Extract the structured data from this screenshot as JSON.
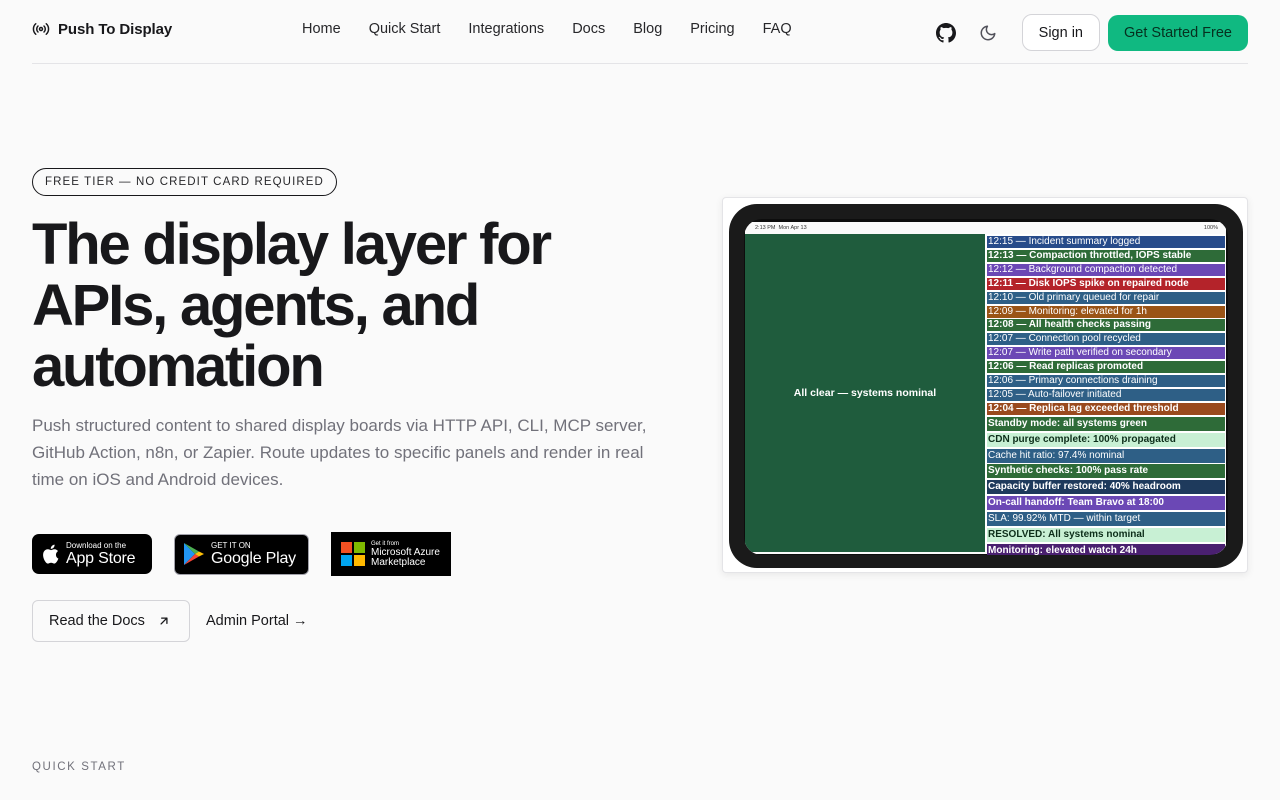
{
  "brand": {
    "name": "Push To Display"
  },
  "nav": {
    "items": [
      "Home",
      "Quick Start",
      "Integrations",
      "Docs",
      "Blog",
      "Pricing",
      "FAQ"
    ]
  },
  "header_actions": {
    "signin": "Sign in",
    "cta": "Get Started Free"
  },
  "hero": {
    "badge": "FREE TIER — NO CREDIT CARD REQUIRED",
    "title": "The display layer for APIs, agents, and automation",
    "subtitle": "Push structured content to shared display boards via HTTP API, CLI, MCP server, GitHub Action, n8n, or Zapier. Route updates to specific panels and render in real time on iOS and Android devices."
  },
  "stores": {
    "apple_small": "Download on the",
    "apple_big": "App Store",
    "google_small": "GET IT ON",
    "google_big": "Google Play",
    "azure_small": "Get it from",
    "azure_big1": "Microsoft Azure",
    "azure_big2": "Marketplace"
  },
  "buttons": {
    "docs": "Read the Docs",
    "admin": "Admin Portal →"
  },
  "section": {
    "quick_start": "QUICK START"
  },
  "device": {
    "time": "2:13 PM",
    "date": "Mon Apr 13",
    "battery": "100%",
    "panel_left": "All clear — systems nominal",
    "log": [
      {
        "text": "12:15 — Incident summary logged",
        "color": "#274b8a",
        "bold": false
      },
      {
        "text": "12:13 — Compaction throttled, IOPS stable",
        "color": "#2e6b38",
        "bold": true
      },
      {
        "text": "12:12 — Background compaction detected",
        "color": "#6b48b5",
        "bold": false
      },
      {
        "text": "12:11 — Disk IOPS spike on repaired node",
        "color": "#b4232a",
        "bold": true
      },
      {
        "text": "12:10 — Old primary queued for repair",
        "color": "#2e5f86",
        "bold": false
      },
      {
        "text": "12:09 — Monitoring: elevated for 1h",
        "color": "#9a5416",
        "bold": false
      },
      {
        "text": "12:08 — All health checks passing",
        "color": "#2e6b38",
        "bold": true
      },
      {
        "text": "12:07 — Connection pool recycled",
        "color": "#2e5f86",
        "bold": false
      },
      {
        "text": "12:07 — Write path verified on secondary",
        "color": "#6b48b5",
        "bold": false
      },
      {
        "text": "12:06 — Read replicas promoted",
        "color": "#2e6b38",
        "bold": true
      },
      {
        "text": "12:06 — Primary connections draining",
        "color": "#2e5f86",
        "bold": false
      },
      {
        "text": "12:05 — Auto-failover initiated",
        "color": "#2e5f86",
        "bold": false
      },
      {
        "text": "12:04 — Replica lag exceeded threshold",
        "color": "#9a4a1e",
        "bold": true
      },
      {
        "text": "Standby mode: all systems green",
        "color": "#2e6b38",
        "bold": true
      },
      {
        "text": "CDN purge complete: 100% propagated",
        "color": "#c8f0d4",
        "bold": true,
        "dark": true
      },
      {
        "text": "Cache hit ratio: 97.4% nominal",
        "color": "#2e5f86",
        "bold": false
      },
      {
        "text": "Synthetic checks: 100% pass rate",
        "color": "#2e6b38",
        "bold": true
      },
      {
        "text": "Capacity buffer restored: 40% headroom",
        "color": "#1e3a5c",
        "bold": true
      },
      {
        "text": "On-call handoff: Team Bravo at 18:00",
        "color": "#6b48b5",
        "bold": true
      },
      {
        "text": "SLA: 99.92% MTD — within target",
        "color": "#2e5f86",
        "bold": false
      },
      {
        "text": "RESOLVED: All systems nominal",
        "color": "#c8f0d4",
        "bold": true,
        "dark": true
      },
      {
        "text": "Monitoring: elevated watch 24h",
        "color": "#4a2070",
        "bold": true
      }
    ]
  },
  "colors": {
    "accent": "#10b981",
    "panel_green": "#1f5c3d"
  },
  "icons": {
    "brand": "broadcast-icon",
    "github": "github-icon",
    "theme": "moon-icon",
    "docs_arrow": "arrow-up-right-icon"
  }
}
